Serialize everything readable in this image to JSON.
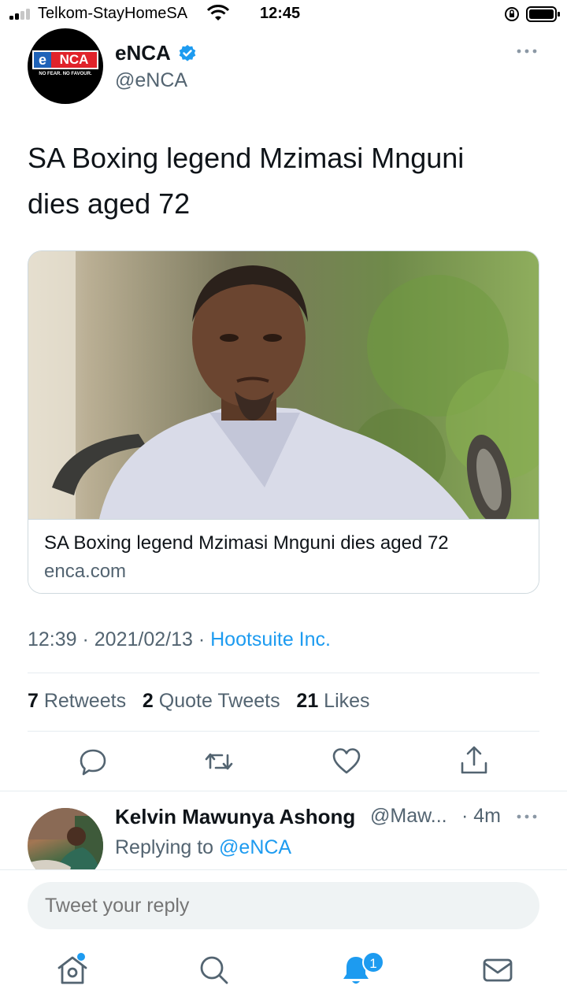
{
  "status_bar": {
    "carrier": "Telkom-StayHomeSA",
    "time": "12:45"
  },
  "tweet": {
    "author": {
      "display_name": "eNCA",
      "handle": "@eNCA",
      "logo": {
        "e": "e",
        "nca": "NCA",
        "tagline": "NO FEAR. NO FAVOUR."
      }
    },
    "text_line1": "SA Boxing legend Mzimasi Mnguni",
    "text_line2": "dies aged 72",
    "card": {
      "title": "SA Boxing legend Mzimasi Mnguni dies aged 72",
      "domain": "enca.com"
    },
    "meta": {
      "time": "12:39",
      "sep1": " · ",
      "date": "2021/02/13",
      "sep2": " · ",
      "source": "Hootsuite Inc."
    },
    "stats": {
      "retweets_count": "7",
      "retweets_label": " Retweets",
      "quotes_count": "2",
      "quotes_label": " Quote Tweets",
      "likes_count": "21",
      "likes_label": " Likes"
    }
  },
  "reply": {
    "name": "Kelvin Mawunya Ashong",
    "handle": "@Maw...",
    "time": "· 4m",
    "replying_prefix": "Replying to ",
    "replying_to": "@eNCA"
  },
  "composer": {
    "placeholder": "Tweet your reply"
  },
  "tabbar": {
    "notifications_badge": "1"
  },
  "colors": {
    "accent": "#1d9bf0",
    "text_primary": "#0f1419",
    "text_secondary": "#536471",
    "enca_red": "#e0232a",
    "enca_blue": "#1e62b8"
  }
}
